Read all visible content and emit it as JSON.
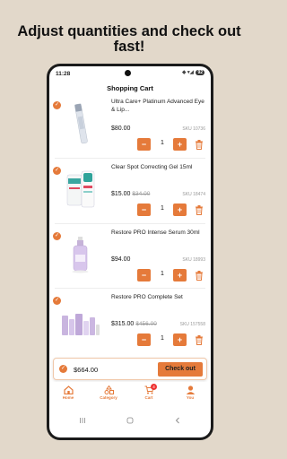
{
  "promo": {
    "headline": "Adjust quantities and check out fast!"
  },
  "status_bar": {
    "time": "11:28",
    "icons": "◆ ▾◢",
    "battery": "92"
  },
  "page": {
    "title": "Shopping Cart"
  },
  "items": [
    {
      "name": "Ultra Care+ Platinum Advanced Eye & Lip...",
      "price": "$80.00",
      "old_price": "",
      "sku": "SKU 10736",
      "qty": "1",
      "selected": true
    },
    {
      "name": "Clear Spot Correcting Gel 15ml",
      "price": "$15.00",
      "old_price": "$34.00",
      "sku": "SKU 18474",
      "qty": "1",
      "selected": true
    },
    {
      "name": "Restore PRO Intense Serum 30ml",
      "price": "$94.00",
      "old_price": "",
      "sku": "SKU 18993",
      "qty": "1",
      "selected": true
    },
    {
      "name": "Restore PRO Complete Set",
      "price": "$315.00",
      "old_price": "$456.00",
      "sku": "SKU 157558",
      "qty": "1",
      "selected": true
    }
  ],
  "qty_controls": {
    "minus": "−",
    "plus": "+"
  },
  "checkout": {
    "total": "$664.00",
    "button": "Check out"
  },
  "nav": [
    {
      "label": "Home",
      "icon": "home-icon"
    },
    {
      "label": "Category",
      "icon": "category-icon"
    },
    {
      "label": "Cart",
      "icon": "cart-icon",
      "badge": "4"
    },
    {
      "label": "You",
      "icon": "user-icon"
    }
  ],
  "colors": {
    "accent": "#e57a3a",
    "background": "#e2d8ca",
    "badge": "#ee3333"
  }
}
